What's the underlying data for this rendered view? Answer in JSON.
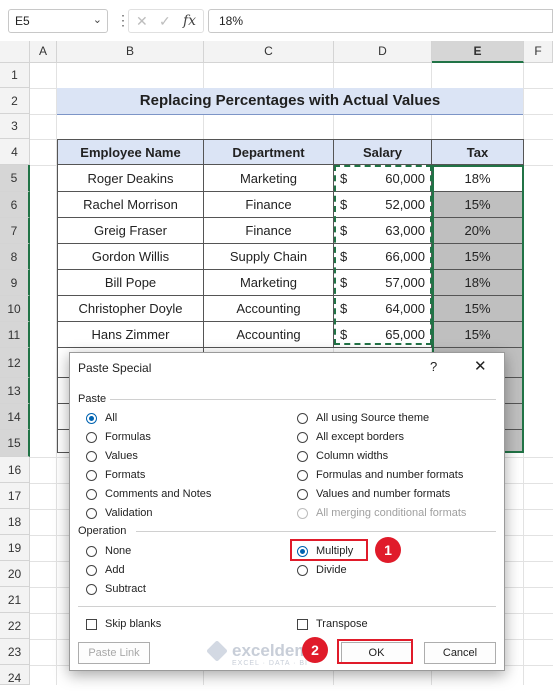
{
  "formula_bar": {
    "name_box": "E5",
    "cancel_icon": "✕",
    "enter_icon": "✓",
    "fx_label": "fx",
    "value": "18%"
  },
  "columns": [
    "A",
    "B",
    "C",
    "D",
    "E",
    "F"
  ],
  "rows": [
    "1",
    "2",
    "3",
    "4",
    "5",
    "6",
    "7",
    "8",
    "9",
    "10",
    "11",
    "12",
    "13",
    "14",
    "15",
    "16",
    "17",
    "18",
    "19",
    "20",
    "21",
    "22",
    "23",
    "24"
  ],
  "sheet": {
    "title": "Replacing Percentages with Actual Values",
    "headers": [
      "Employee Name",
      "Department",
      "Salary",
      "Tax"
    ],
    "data": [
      {
        "name": "Roger Deakins",
        "dept": "Marketing",
        "cur": "$",
        "salary": "60,000",
        "tax": "18%"
      },
      {
        "name": "Rachel Morrison",
        "dept": "Finance",
        "cur": "$",
        "salary": "52,000",
        "tax": "15%"
      },
      {
        "name": "Greig Fraser",
        "dept": "Finance",
        "cur": "$",
        "salary": "63,000",
        "tax": "20%"
      },
      {
        "name": "Gordon Willis",
        "dept": "Supply Chain",
        "cur": "$",
        "salary": "66,000",
        "tax": "15%"
      },
      {
        "name": "Bill Pope",
        "dept": "Marketing",
        "cur": "$",
        "salary": "57,000",
        "tax": "18%"
      },
      {
        "name": "Christopher Doyle",
        "dept": "Accounting",
        "cur": "$",
        "salary": "64,000",
        "tax": "15%"
      },
      {
        "name": "Hans Zimmer",
        "dept": "Accounting",
        "cur": "$",
        "salary": "65,000",
        "tax": "15%"
      }
    ]
  },
  "dialog": {
    "title": "Paste Special",
    "help": "?",
    "close": "✕",
    "paste_group": "Paste",
    "paste_left": [
      "All",
      "Formulas",
      "Values",
      "Formats",
      "Comments and Notes",
      "Validation"
    ],
    "paste_right": [
      "All using Source theme",
      "All except borders",
      "Column widths",
      "Formulas and number formats",
      "Values and number formats",
      "All merging conditional formats"
    ],
    "operation_group": "Operation",
    "op_left": [
      "None",
      "Add",
      "Subtract"
    ],
    "op_right": [
      "Multiply",
      "Divide"
    ],
    "skip_blanks": "Skip blanks",
    "transpose": "Transpose",
    "paste_link": "Paste Link",
    "ok": "OK",
    "cancel": "Cancel"
  },
  "badges": [
    "1",
    "2"
  ],
  "watermark": {
    "name": "exceldemy",
    "tagline": "EXCEL · DATA · BI"
  },
  "colors": {
    "accent": "#217346",
    "header_fill": "#dbe4f5",
    "highlight": "#e01b2a",
    "radio_on": "#0063b1"
  }
}
